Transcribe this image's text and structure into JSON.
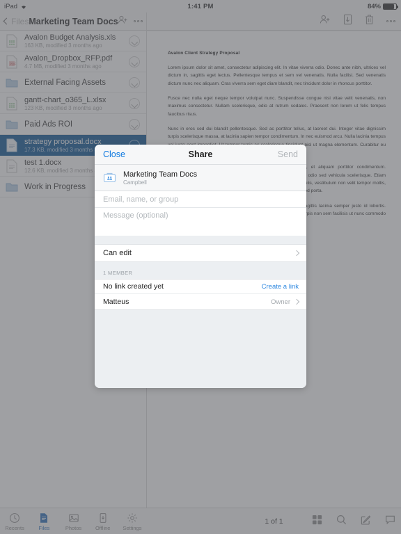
{
  "status_bar": {
    "device": "iPad",
    "wifi_icon": "wifi-icon",
    "time": "1:41 PM",
    "battery_percent": "84%",
    "battery_level": 84
  },
  "sidebar": {
    "back_label": "Files",
    "title": "Marketing Team Docs",
    "add_person_icon": "person-plus-icon",
    "more_icon": "more-horizontal-icon",
    "files": [
      {
        "name": "Avalon Budget Analysis.xls",
        "meta": "163 KB, modified 3 months ago",
        "type": "spreadsheet",
        "selected": false
      },
      {
        "name": "Avalon_Dropbox_RFP.pdf",
        "meta": "4.7 MB, modified 3 months ago",
        "type": "pdf",
        "selected": false
      },
      {
        "name": "External Facing Assets",
        "meta": "",
        "type": "folder",
        "selected": false
      },
      {
        "name": "gantt-chart_o365_L.xlsx",
        "meta": "123 KB, modified 3 months ago",
        "type": "spreadsheet",
        "selected": false
      },
      {
        "name": "Paid Ads ROI",
        "meta": "",
        "type": "folder",
        "selected": false
      },
      {
        "name": "strategy proposal.docx",
        "meta": "17.3 KB, modified 3 months ago",
        "type": "document",
        "selected": true
      },
      {
        "name": "test 1.docx",
        "meta": "12.6 KB, modified 3 months ago",
        "type": "document",
        "selected": false
      },
      {
        "name": "Work in Progress",
        "meta": "",
        "type": "folder",
        "selected": false
      }
    ],
    "tabs": [
      {
        "label": "Recents",
        "icon": "clock-icon",
        "active": false
      },
      {
        "label": "Files",
        "icon": "file-icon",
        "active": true
      },
      {
        "label": "Photos",
        "icon": "photo-icon",
        "active": false
      },
      {
        "label": "Offline",
        "icon": "offline-device-icon",
        "active": false
      },
      {
        "label": "Settings",
        "icon": "gear-icon",
        "active": false
      }
    ]
  },
  "preview": {
    "toolbar_icons": [
      "person-plus-icon",
      "save-to-device-icon",
      "trash-icon",
      "more-horizontal-icon"
    ],
    "doc_heading": "Avalon Client Strategy Proposal",
    "paragraphs": [
      "Lorem ipsum dolor sit amet, consectetur adipiscing elit. In vitae viverra odio. Donec ante nibh, ultrices vel dictum in, sagittis eget lectus. Pellentesque tempus et sem vel venenatis. Nulla facilisi. Sed venenatis dictum nunc nec aliquam. Cras viverra sem eget diam blandit, nec tincidunt dolor in rhoncus porttitor.",
      "Fusce nec nulla eget neque tempor volutpat nunc. Suspendisse congue nisi vitae velit venenatis, non maximus consectetur. Nullam scelerisque, odio at rutrum sodales. Praesent non lorem ut felis tempus faucibus risus.",
      "Nunc in eros sed dui blandit pellentesque. Sed ac porttitor tellus, at laoreet dui. Integer vitae dignissim turpis scelerisque massa, at lacinia sapien tempor condimentum. In nec euismod arcu. Nulla lacinia tempus vel justo eget imperdiet. Ut tempor turpis ac scelerisque tincidunt nisl ut magna elementum. Curabitur eu diam lectus.",
      "Pellentesque habitant morbi vestibulum hendrerit metus ligula, et aliquam porttitor condimentum. Maecenas in metus lacinia, porta ac elit. Donec facilisis tincidunt odio sed vehicula scelerisque. Etiam lorem ipsum porta porttitor neque sed tristique. In faucibus metus felis, vestibulum non velit tempor mollis, elit nunc ultrices velit, id egestas mollis. Donec scelerisque augue sed porta.",
      "Quisque tincidunt tempor ante nulla, a volutpat ante dolor vel sagittis lacinia semper justo id lobortis. Integer neque vehicula tortor, id iaculis felis ornare. Praesent sed turpis non sem facilisis ut nunc commodo hendrerit."
    ],
    "page_indicator": "1 of 1",
    "bottom_icons": [
      "grid-icon",
      "search-icon",
      "annotate-icon",
      "comment-icon"
    ]
  },
  "share_modal": {
    "close_label": "Close",
    "title": "Share",
    "send_label": "Send",
    "folder_icon": "shared-folder-icon",
    "folder_name": "Marketing Team Docs",
    "folder_owner": "Campbell",
    "recipient_placeholder": "Email, name, or group",
    "message_placeholder": "Message (optional)",
    "permission_label": "Can edit",
    "member_section_header": "1 MEMBER",
    "link_status": "No link created yet",
    "create_link_label": "Create a link",
    "member_name": "Matteus",
    "member_role": "Owner"
  },
  "colors": {
    "accent_blue": "#0f7ae0",
    "link_blue": "#2e88e0",
    "selected_row": "#0b5394",
    "tab_active": "#2a6ebb",
    "dim_overlay": "rgba(90,92,96,0.58)"
  }
}
